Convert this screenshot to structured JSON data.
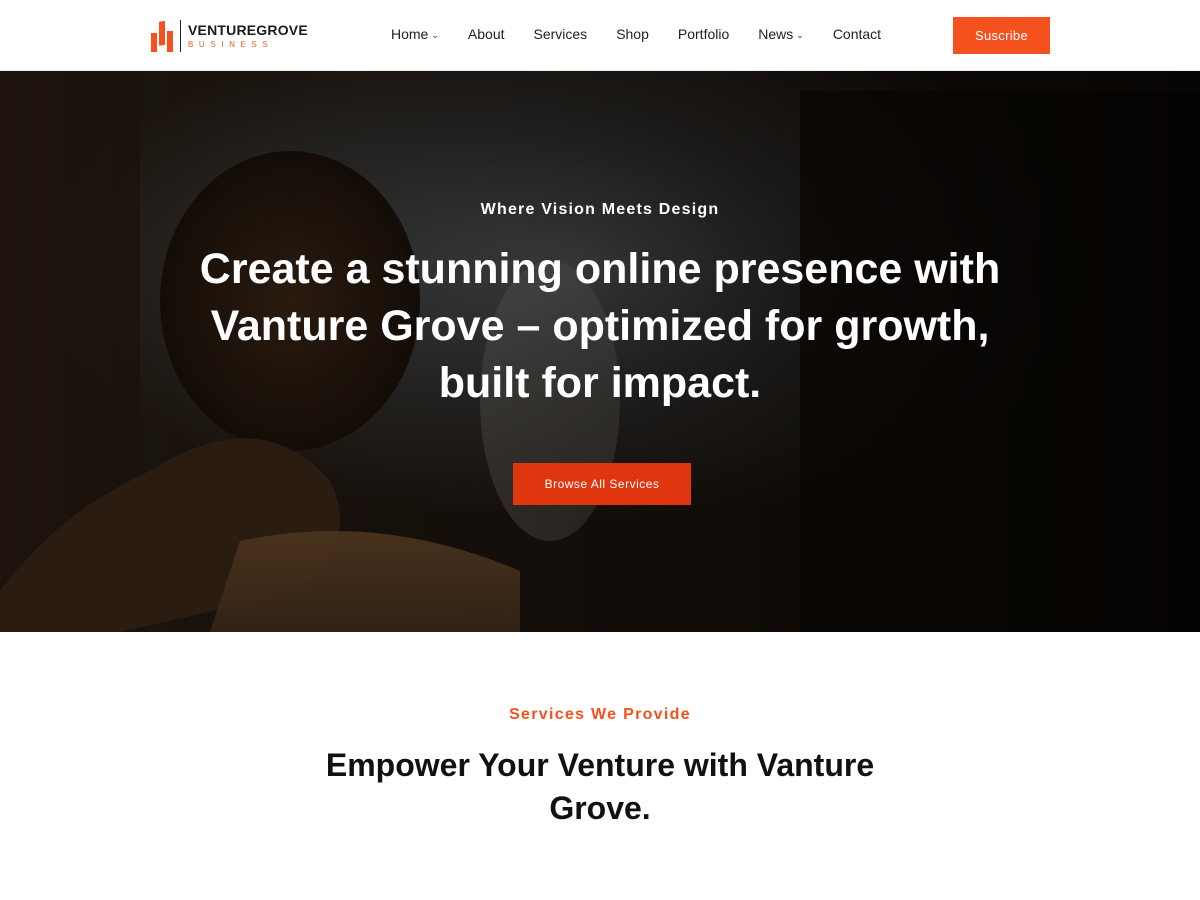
{
  "brand": {
    "name": "VENTUREGROVE",
    "tagline": "BUSINESS",
    "accent_color": "#f4511e"
  },
  "nav": {
    "items": [
      {
        "label": "Home",
        "dropdown": true
      },
      {
        "label": "About",
        "dropdown": false
      },
      {
        "label": "Services",
        "dropdown": false
      },
      {
        "label": "Shop",
        "dropdown": false
      },
      {
        "label": "Portfolio",
        "dropdown": false
      },
      {
        "label": "News",
        "dropdown": true
      },
      {
        "label": "Contact",
        "dropdown": false
      }
    ],
    "cta_label": "Suscribe"
  },
  "hero": {
    "eyebrow": "Where Vision Meets Design",
    "title": "Create a stunning online presence with Vanture Grove – optimized for growth, built for impact.",
    "button_label": "Browse All Services"
  },
  "services": {
    "eyebrow": "Services We Provide",
    "title": "Empower Your Venture with Vanture Grove."
  },
  "icons": {
    "logo": "bar-chart-logo-icon",
    "dropdown": "chevron-down-icon"
  }
}
